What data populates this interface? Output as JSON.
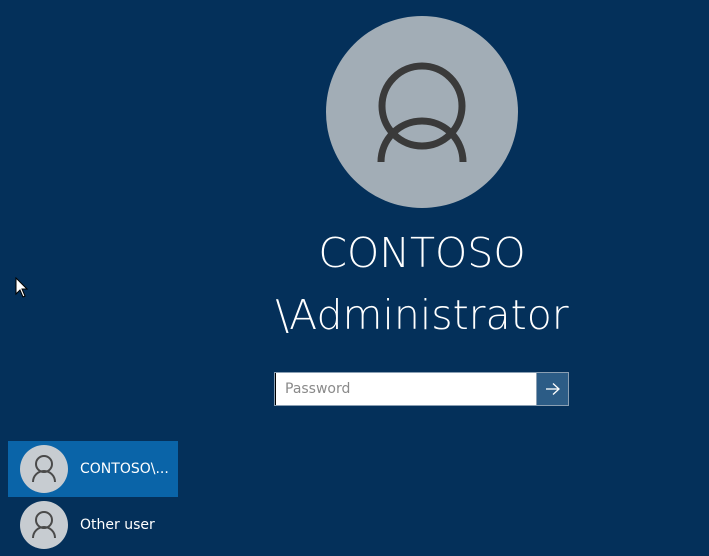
{
  "current_user": {
    "domain_line": "CONTOSO",
    "account_line": "\\Administrator",
    "avatar_icon": "user-silhouette-icon"
  },
  "password": {
    "placeholder": "Password",
    "value": "",
    "submit_icon": "arrow-right-icon"
  },
  "user_list": [
    {
      "label": "CONTOSO\\...",
      "selected": true,
      "icon": "user-silhouette-icon"
    },
    {
      "label": "Other user",
      "selected": false,
      "icon": "user-silhouette-icon"
    }
  ],
  "colors": {
    "background": "#04305a",
    "avatar_bg": "#a2adb6",
    "selected_tile": "#0a64a8",
    "submit_button": "#2c5c86"
  }
}
